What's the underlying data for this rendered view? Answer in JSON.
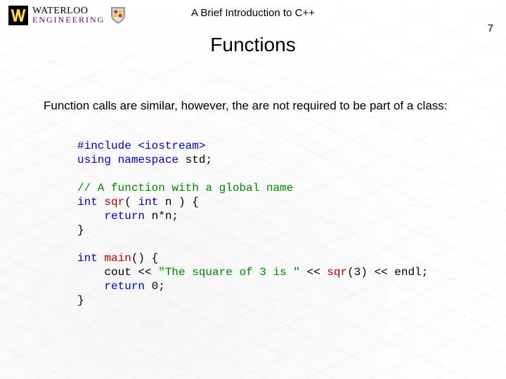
{
  "header": {
    "brand_top": "WATERLOO",
    "brand_bottom": "ENGINEERING"
  },
  "doc_title": "A Brief Introduction to C++",
  "page_number": "7",
  "slide_title": "Functions",
  "body_text": "Function calls are similar, however, the are not required to be part of a class:",
  "code": {
    "l1": {
      "a": "#include <iostream>"
    },
    "l2": {
      "a": "using namespace",
      "b": " std;"
    },
    "l3": {
      "a": ""
    },
    "l4": {
      "a": "// A function with a global name"
    },
    "l5": {
      "a": "int",
      "b": " ",
      "c": "sqr",
      "d": "( ",
      "e": "int",
      "f": " n ) {"
    },
    "l6": {
      "a": "    ",
      "b": "return",
      "c": " n*n;"
    },
    "l7": {
      "a": "}"
    },
    "l8": {
      "a": ""
    },
    "l9": {
      "a": "int",
      "b": " ",
      "c": "main",
      "d": "() {"
    },
    "l10": {
      "a": "    cout << ",
      "b": "\"The square of 3 is \"",
      "c": " << ",
      "d": "sqr",
      "e": "(3) << endl;"
    },
    "l11": {
      "a": "    ",
      "b": "return",
      "c": " 0;"
    },
    "l12": {
      "a": "}"
    }
  }
}
